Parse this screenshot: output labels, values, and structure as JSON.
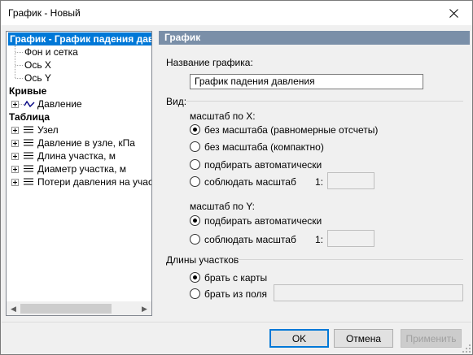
{
  "window": {
    "title": "График - Новый"
  },
  "tree": {
    "nodes": {
      "root": "График - График падения давления",
      "background": "Фон и сетка",
      "axis_x": "Ось X",
      "axis_y": "Ось Y",
      "curves": "Кривые",
      "curve_pressure": "Давление",
      "table": "Таблица",
      "col_node": "Узел",
      "col_pressure": "Давление в узле, кПа",
      "col_length": "Длина участка, м",
      "col_diameter": "Диаметр участка, м",
      "col_losses": "Потери давления на участке"
    }
  },
  "panel": {
    "header": "График",
    "chart_name_label": "Название графика:",
    "chart_name_value": "График падения давления",
    "view_group": "Вид:",
    "scale_x_label": "масштаб по X:",
    "scale_x_options": {
      "no_scale_uniform": "без масштаба (равномерные отсчеты)",
      "no_scale_compact": "без масштаба (компактно)",
      "auto": "подбирать автоматически",
      "keep": "соблюдать масштаб"
    },
    "scale_x_ratio_label": "1:",
    "scale_x_selected": "no_scale_uniform",
    "scale_y_label": "масштаб по Y:",
    "scale_y_options": {
      "auto": "подбирать автоматически",
      "keep": "соблюдать масштаб"
    },
    "scale_y_ratio_label": "1:",
    "scale_y_selected": "auto",
    "lengths_group": "Длины участков",
    "lengths_options": {
      "from_map": "брать с карты",
      "from_field": "брать из поля"
    },
    "lengths_selected": "from_map"
  },
  "buttons": {
    "ok": "OK",
    "cancel": "Отмена",
    "apply": "Применить"
  },
  "colors": {
    "accent": "#0078d7",
    "header_bar": "#7a8fa8"
  },
  "icons": {
    "close": "close-icon",
    "expander": "plus-expander-icon",
    "curve": "wave-icon",
    "column": "lines-icon"
  }
}
